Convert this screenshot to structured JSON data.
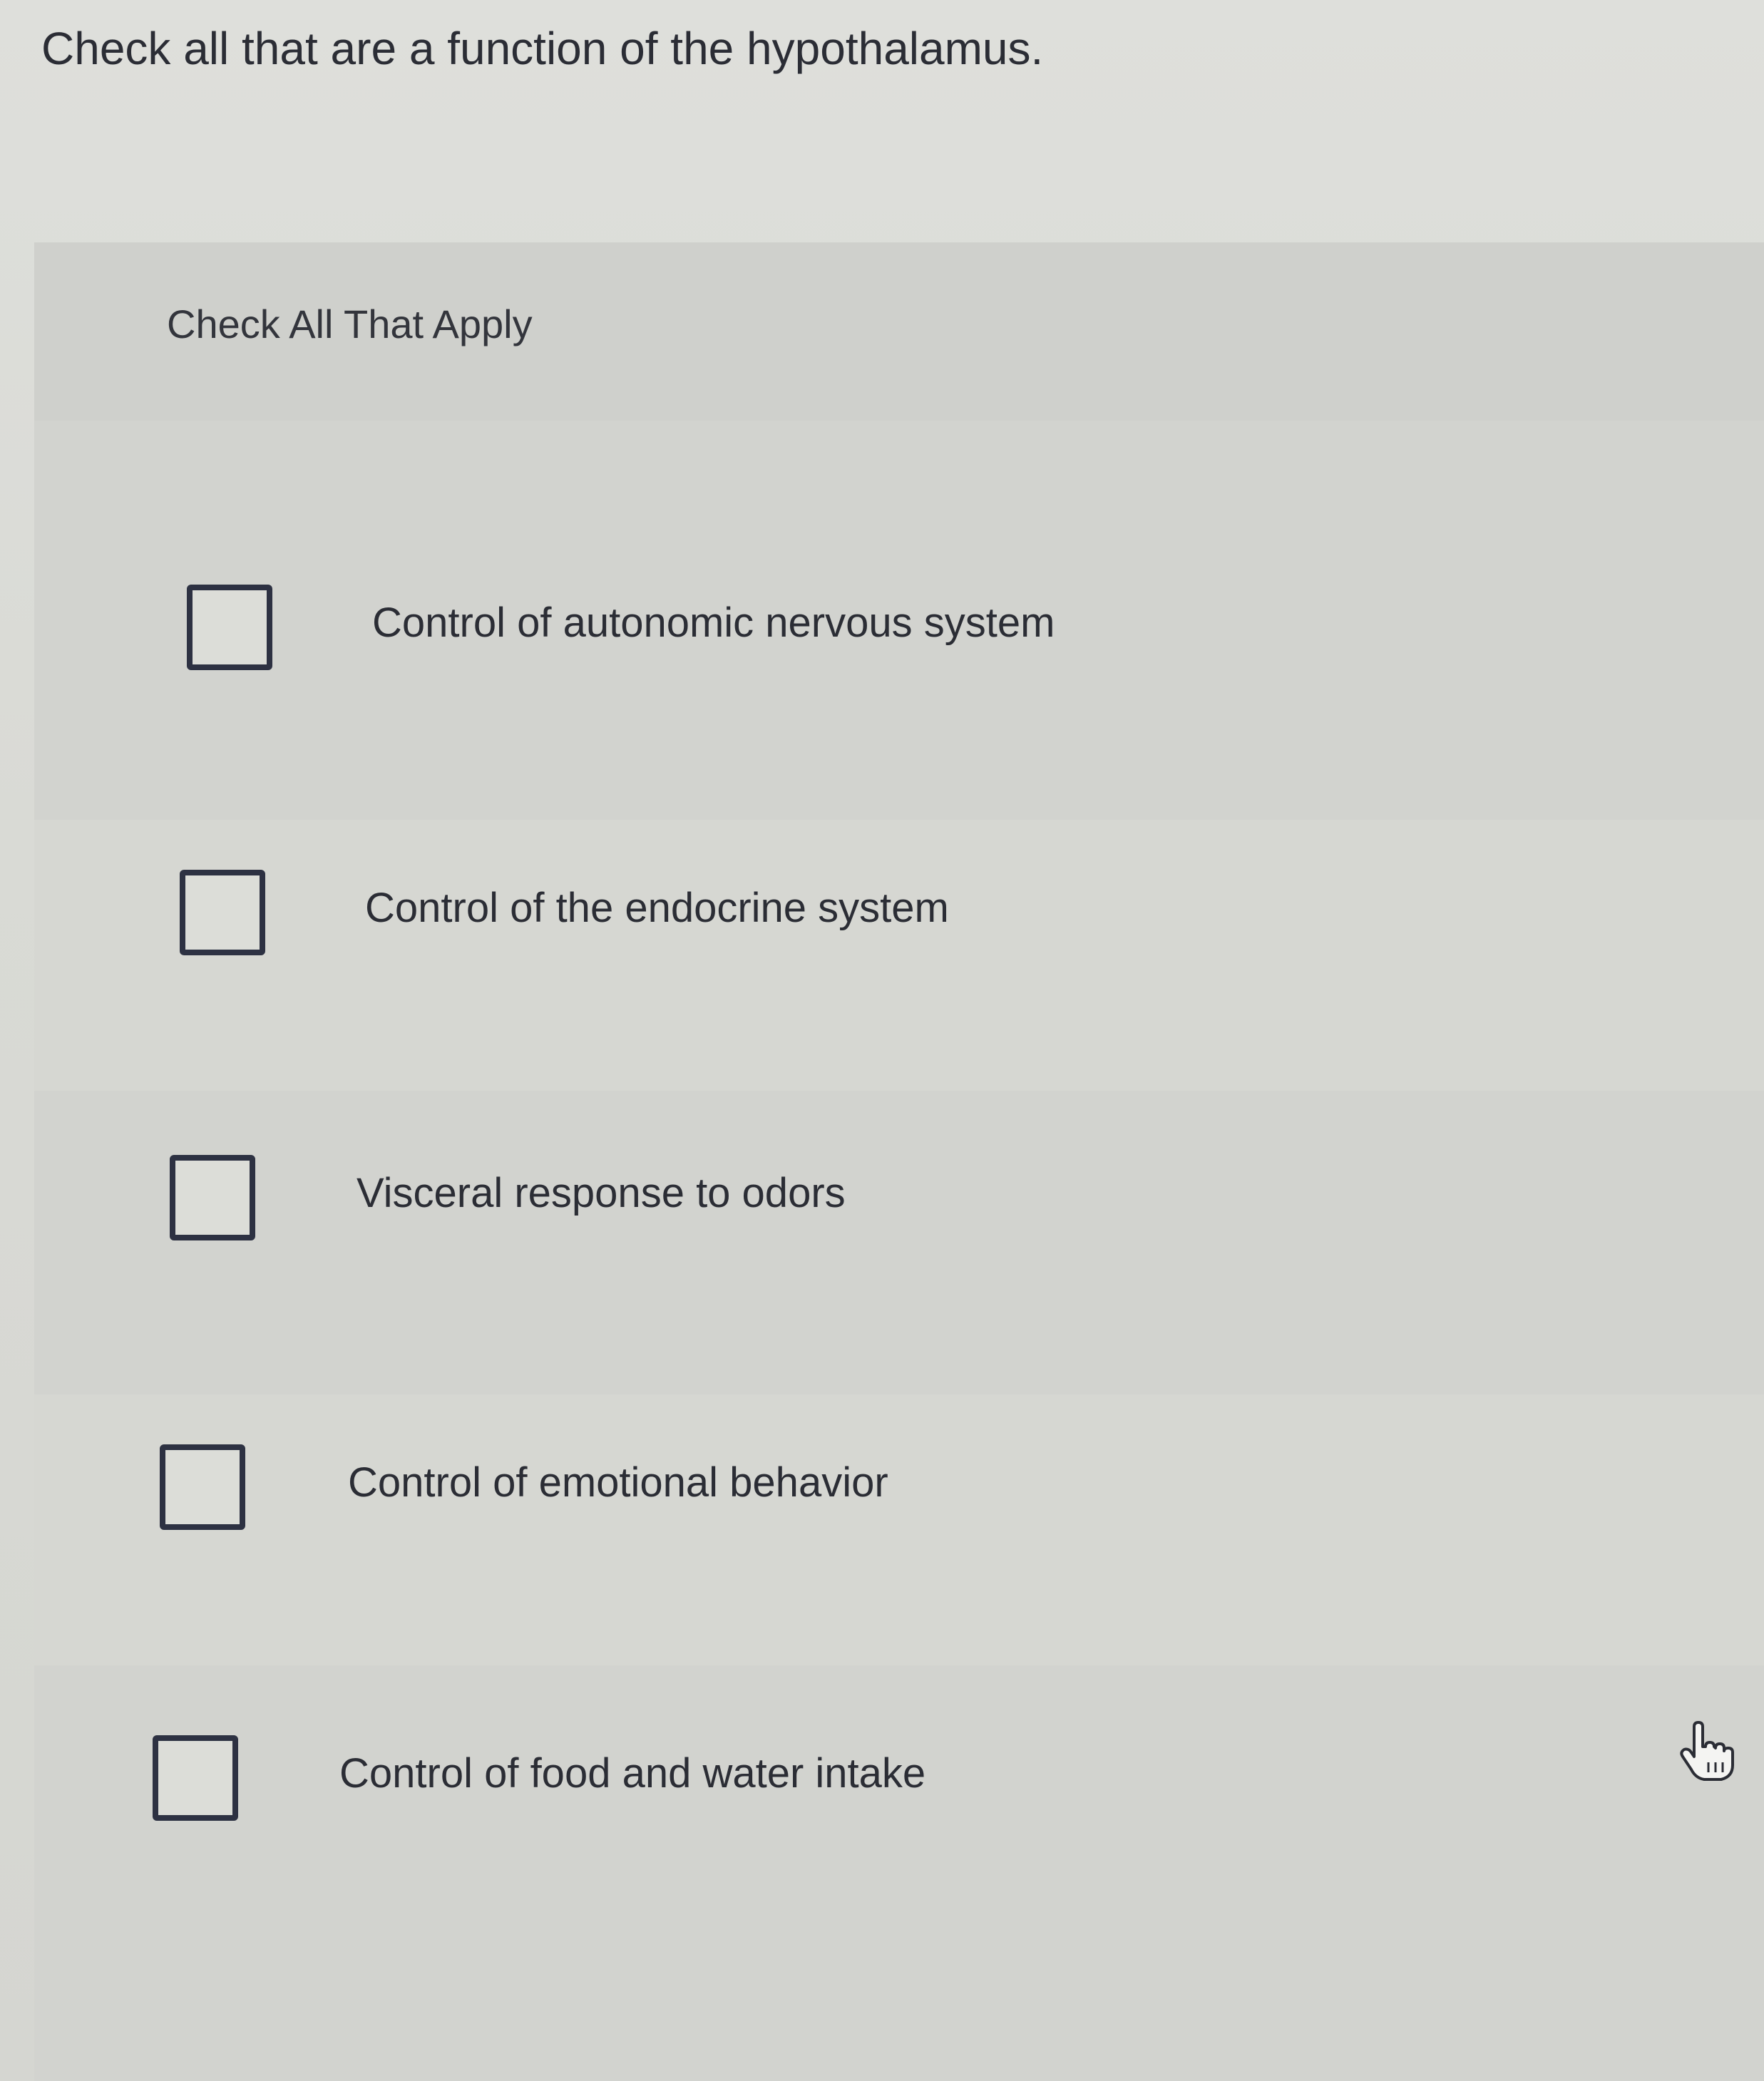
{
  "question": {
    "text": "Check all that are a function of the hypothalamus."
  },
  "instruction": {
    "text": "Check All That Apply"
  },
  "options": [
    {
      "label": "Control of autonomic nervous system",
      "checked": false
    },
    {
      "label": "Control of the endocrine system",
      "checked": false
    },
    {
      "label": "Visceral response to odors",
      "checked": false
    },
    {
      "label": "Control of emotional behavior",
      "checked": false
    },
    {
      "label": "Control of food and water intake",
      "checked": false
    }
  ],
  "cursor": {
    "icon": "hand-pointer-icon"
  },
  "colors": {
    "text": "#2b2d35",
    "checkbox_border": "#2d3142",
    "background": "#d9dad6"
  }
}
